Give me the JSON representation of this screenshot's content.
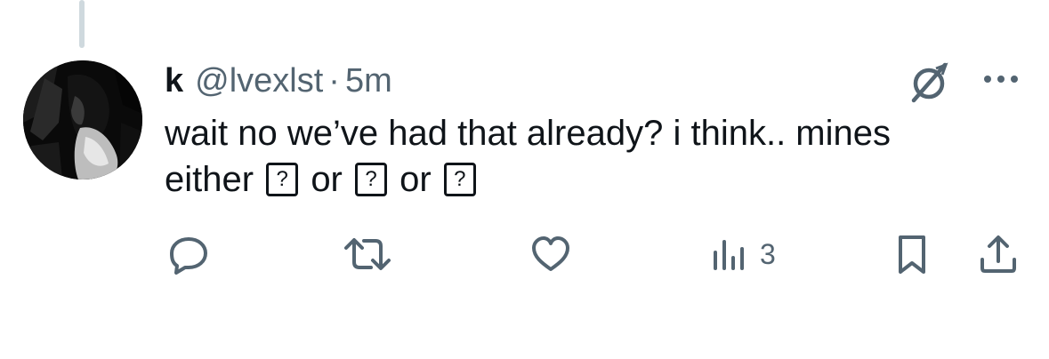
{
  "post": {
    "display_name": "k",
    "handle": "@lvexlst",
    "separator": "·",
    "timestamp": "5m",
    "text_line1": "wait no we’ve had that already? i think.. mines",
    "text_line2_word1": "either",
    "text_line2_or1": "or",
    "text_line2_or2": "or",
    "unknown_glyph": "?"
  },
  "actions": {
    "views_count": "3"
  },
  "icons": {
    "grok": "grok-icon",
    "more": "more-dots-icon",
    "reply": "reply-icon",
    "repost": "repost-icon",
    "like": "heart-icon",
    "views": "views-icon",
    "bookmark": "bookmark-icon",
    "share": "share-icon"
  },
  "colors": {
    "text_primary": "#0f1419",
    "text_secondary": "#536471",
    "thread_line": "#cfd9de"
  }
}
